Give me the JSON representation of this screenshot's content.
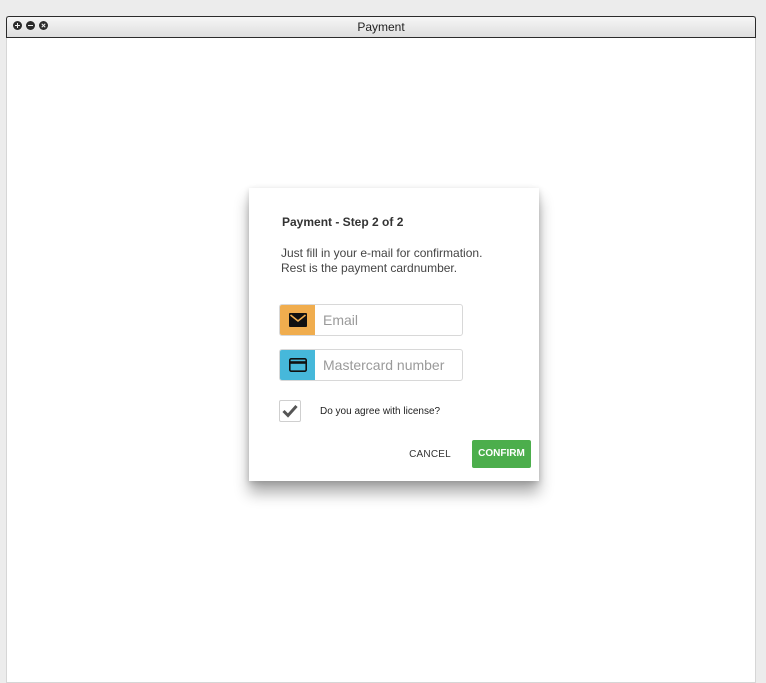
{
  "window": {
    "title": "Payment"
  },
  "dialog": {
    "title": "Payment - Step 2 of 2",
    "description_line1": "Just fill in your e-mail for confirmation.",
    "description_line2": "Rest is the payment cardnumber.",
    "email": {
      "placeholder": "Email",
      "value": "",
      "icon": "envelope-icon",
      "icon_bg": "#f0ad4e"
    },
    "card": {
      "placeholder": "Mastercard number",
      "value": "",
      "icon": "credit-card-icon",
      "icon_bg": "#46b8da"
    },
    "license": {
      "label": "Do you agree with license?",
      "checked": true
    },
    "cancel_label": "CANCEL",
    "confirm_label": "CONFIRM",
    "confirm_color": "#4cae4c"
  }
}
